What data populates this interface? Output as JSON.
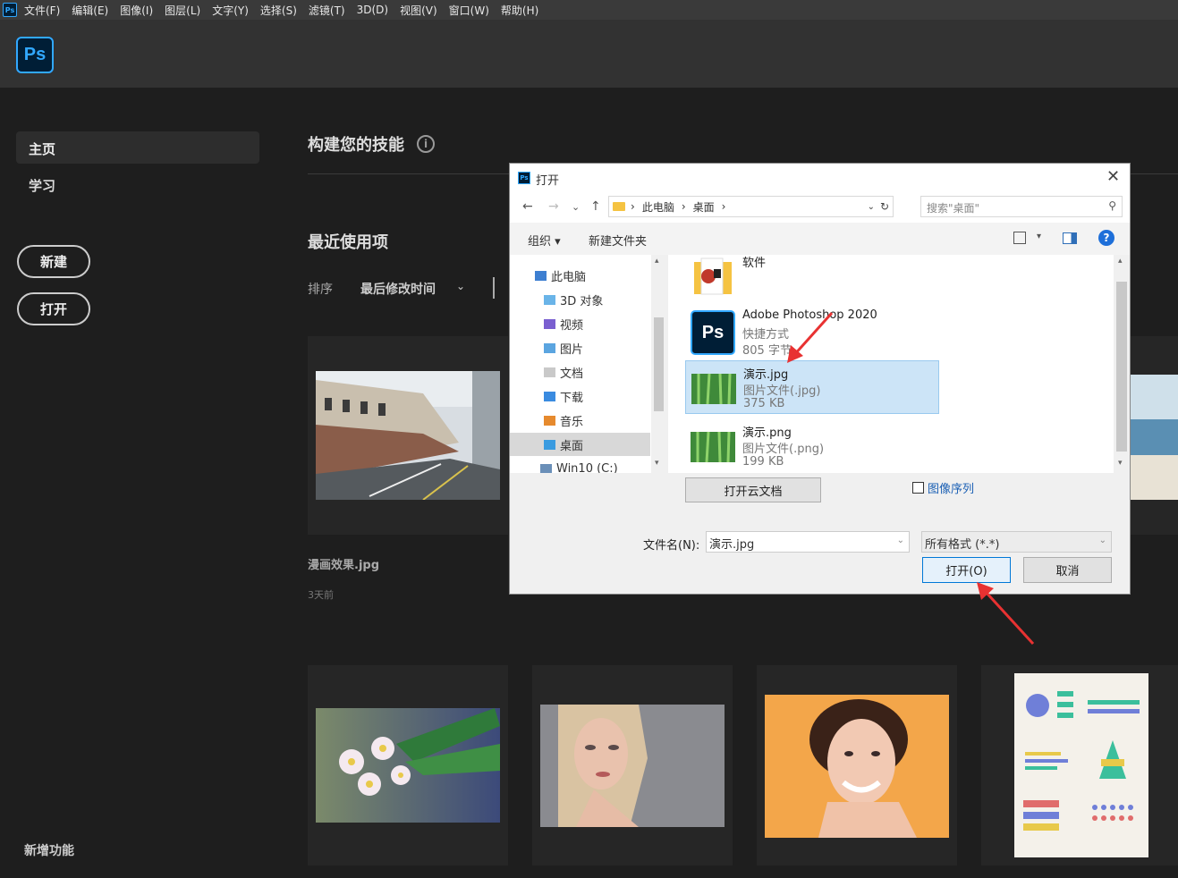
{
  "menu": {
    "app_icon": "Ps",
    "items": [
      "文件(F)",
      "编辑(E)",
      "图像(I)",
      "图层(L)",
      "文字(Y)",
      "选择(S)",
      "滤镜(T)",
      "3D(D)",
      "视图(V)",
      "窗口(W)",
      "帮助(H)"
    ]
  },
  "header": {
    "logo": "Ps"
  },
  "sidebar": {
    "home": "主页",
    "learn": "学习",
    "new_button": "新建",
    "open_button": "打开",
    "whats_new": "新增功能"
  },
  "main": {
    "skills_title": "构建您的技能",
    "info_icon": "i",
    "recent_title": "最近使用项",
    "sort_label": "排序",
    "sort_value": "最后修改时间",
    "sort_chevron": "⌄",
    "recent_items": [
      {
        "name": "漫画效果.jpg",
        "time": "3天前",
        "thumb": "street-photo"
      }
    ],
    "other_thumbs": [
      "sea-photo",
      "flower-photo",
      "blonde-portrait-photo",
      "smiling-woman-photo",
      "infographic-photo"
    ]
  },
  "dialog": {
    "title": "打开",
    "close": "✕",
    "nav": {
      "back": "←",
      "forward": "→",
      "recent": "⌄",
      "up": "↑"
    },
    "breadcrumb": [
      "此电脑",
      "›",
      "桌面",
      "›"
    ],
    "breadcrumb_lead": "›",
    "addr_dropdown": "⌄",
    "refresh": "↻",
    "search_placeholder": "搜索\"桌面\"",
    "search_icon": "⚲",
    "toolbar": {
      "organize": "组织 ▾",
      "new_folder": "新建文件夹",
      "view_dd": "▾",
      "help": "?"
    },
    "tree": [
      {
        "label": "此电脑",
        "icon": "pc-icon",
        "color": "#3d7fd1"
      },
      {
        "label": "3D 对象",
        "icon": "3d-objects-icon",
        "color": "#6ab4e8"
      },
      {
        "label": "视频",
        "icon": "video-folder-icon",
        "color": "#7a5fd0"
      },
      {
        "label": "图片",
        "icon": "pictures-folder-icon",
        "color": "#5ba5e0"
      },
      {
        "label": "文档",
        "icon": "documents-folder-icon",
        "color": "#c9c9c9"
      },
      {
        "label": "下载",
        "icon": "downloads-folder-icon",
        "color": "#3a8be0"
      },
      {
        "label": "音乐",
        "icon": "music-folder-icon",
        "color": "#e68a2e"
      },
      {
        "label": "桌面",
        "icon": "desktop-folder-icon",
        "color": "#3a9be0"
      },
      {
        "label": "Win10 (C:)",
        "icon": "drive-icon",
        "color": "#6a8fb8"
      }
    ],
    "tree_selected_index": 7,
    "scroll_up": "▴",
    "scroll_down": "▾",
    "files": [
      {
        "name": "软件",
        "type": "",
        "size": "",
        "icon": "folder-icon"
      },
      {
        "name": "Adobe Photoshop 2020",
        "type": "快捷方式",
        "size": "805 字节",
        "icon": "photoshop-shortcut-icon",
        "icon_text": "Ps"
      },
      {
        "name": "演示.jpg",
        "type": "图片文件(.jpg)",
        "size": "375 KB",
        "icon": "bamboo-image-icon"
      },
      {
        "name": "演示.png",
        "type": "图片文件(.png)",
        "size": "199 KB",
        "icon": "bamboo-image-icon"
      }
    ],
    "file_selected_index": 2,
    "open_cloud_button": "打开云文档",
    "image_sequence_label": "图像序列",
    "image_sequence_checked": false,
    "filename_label": "文件名(N):",
    "filename_value": "演示.jpg",
    "filetype_value": "所有格式 (*.*)",
    "open_button": "打开(O)",
    "cancel_button": "取消",
    "dropdown_glyph": "⌄"
  },
  "colors": {
    "accent": "#31a8ff",
    "annotation_arrow": "#e83232",
    "selection": "#cce4f7"
  }
}
